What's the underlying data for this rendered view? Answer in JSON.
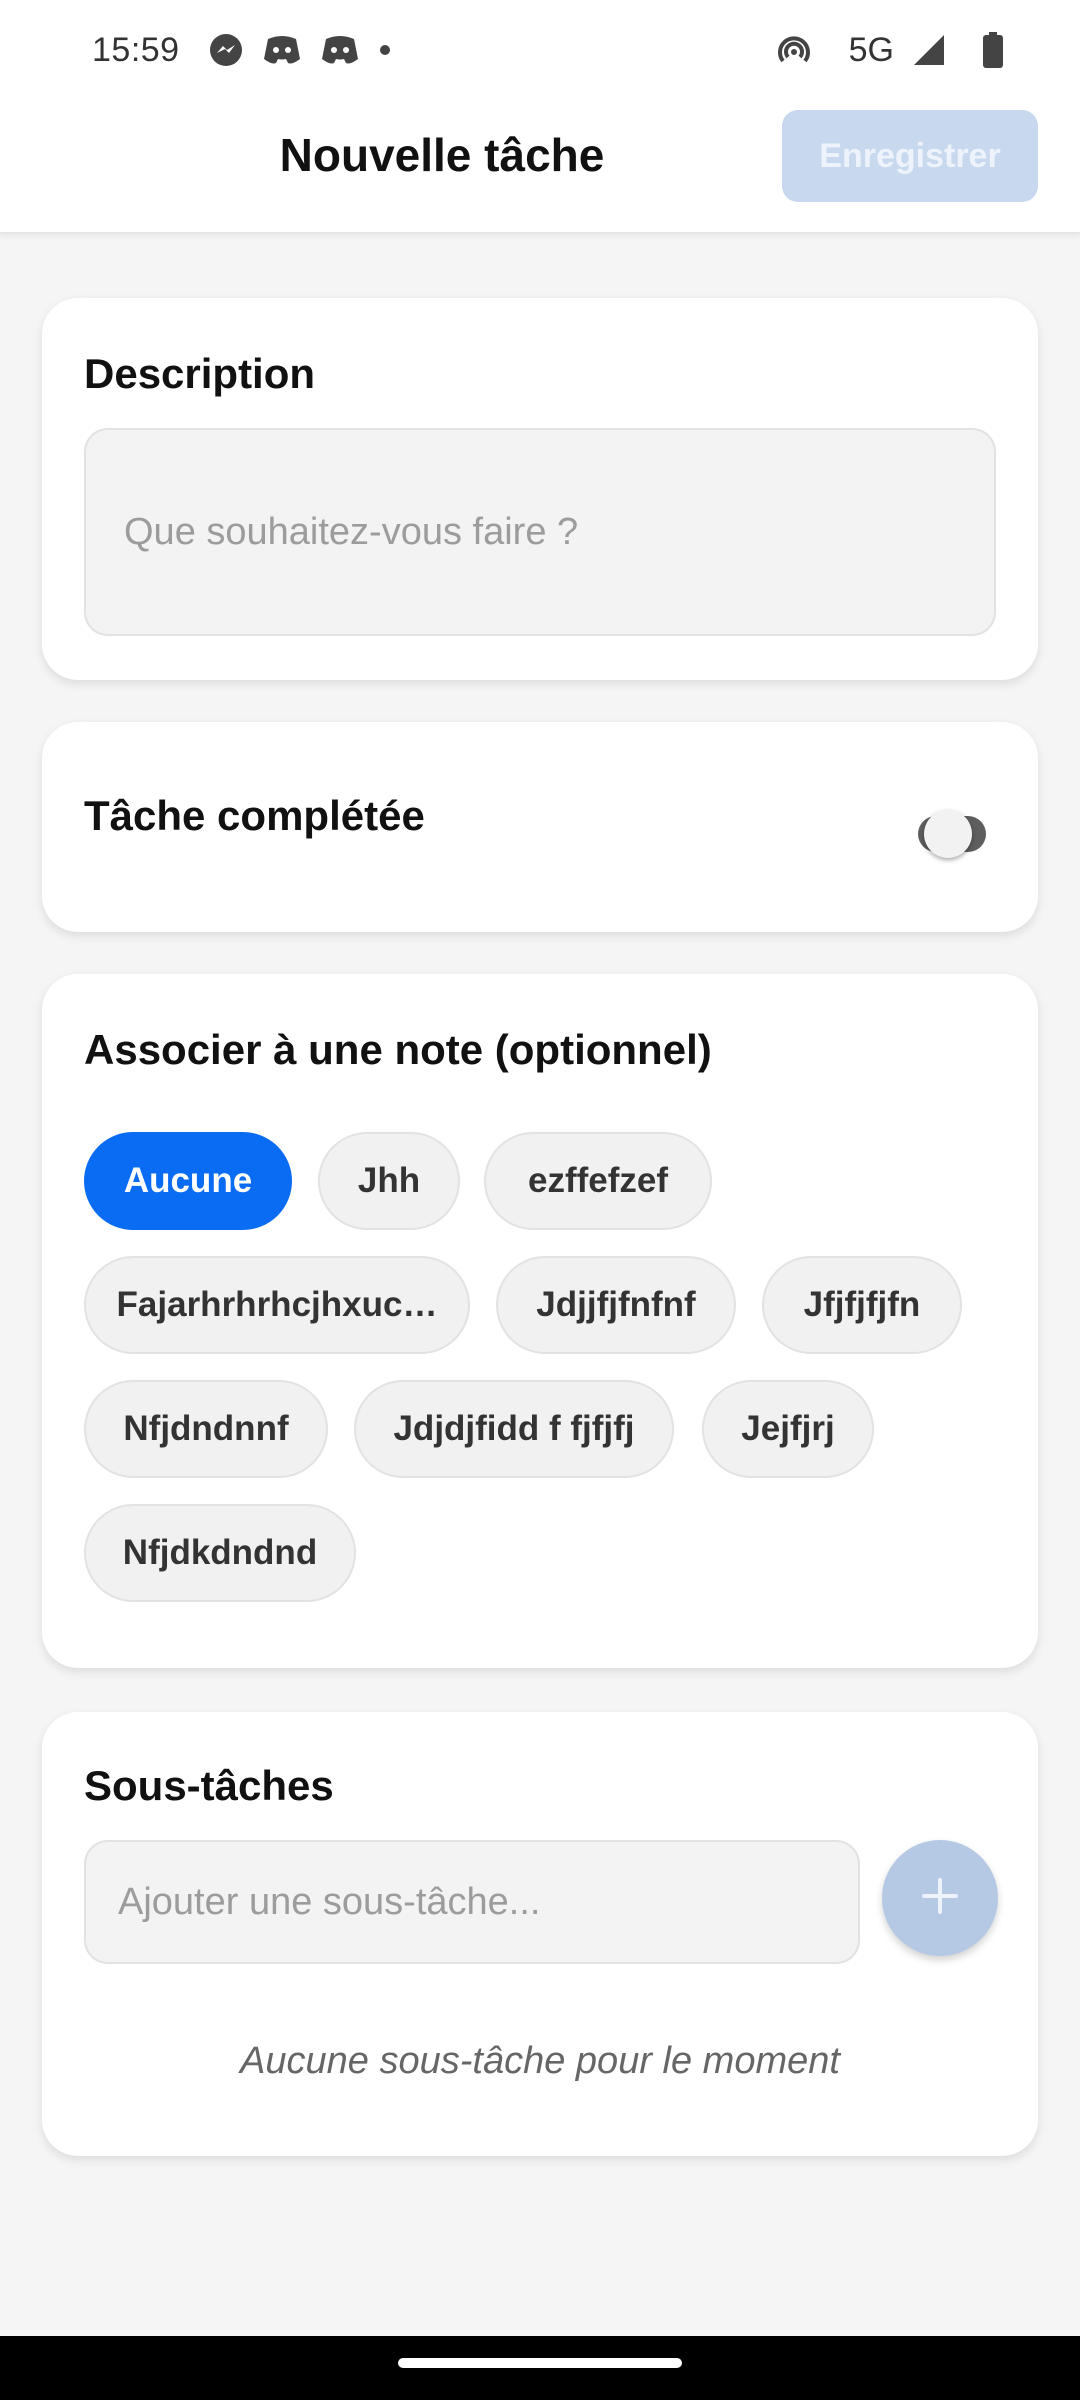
{
  "status_bar": {
    "time": "15:59",
    "notification_icons": [
      "messenger-icon",
      "discord-icon",
      "discord-icon",
      "dot-icon"
    ],
    "network": "5G",
    "right_icons": [
      "hotspot-icon",
      "signal-icon",
      "battery-icon"
    ]
  },
  "header": {
    "title": "Nouvelle tâche",
    "save_label": "Enregistrer"
  },
  "description": {
    "label": "Description",
    "placeholder": "Que souhaitez-vous faire ?",
    "value": ""
  },
  "completed": {
    "label": "Tâche complétée",
    "value": false
  },
  "note": {
    "label": "Associer à une note (optionnel)",
    "selected": "Aucune",
    "options": [
      "Aucune",
      "Jhh",
      "ezffefzef",
      "Fajarhrhrhcjhxuc…",
      "Jdjjfjfnfnf",
      "Jfjfjfjfn",
      "Nfjdndnnf",
      "Jdjdjfidd f fjfjfj",
      "Jejfjrj",
      "Nfjdkdndnd"
    ]
  },
  "subtasks": {
    "label": "Sous-tâches",
    "placeholder": "Ajouter une sous-tâche...",
    "add_icon": "plus-icon",
    "empty_text": "Aucune sous-tâche pour le moment"
  },
  "colors": {
    "accent": "#0a6cf2",
    "save_disabled": "#c8d8ee",
    "background": "#f5f5f5"
  }
}
